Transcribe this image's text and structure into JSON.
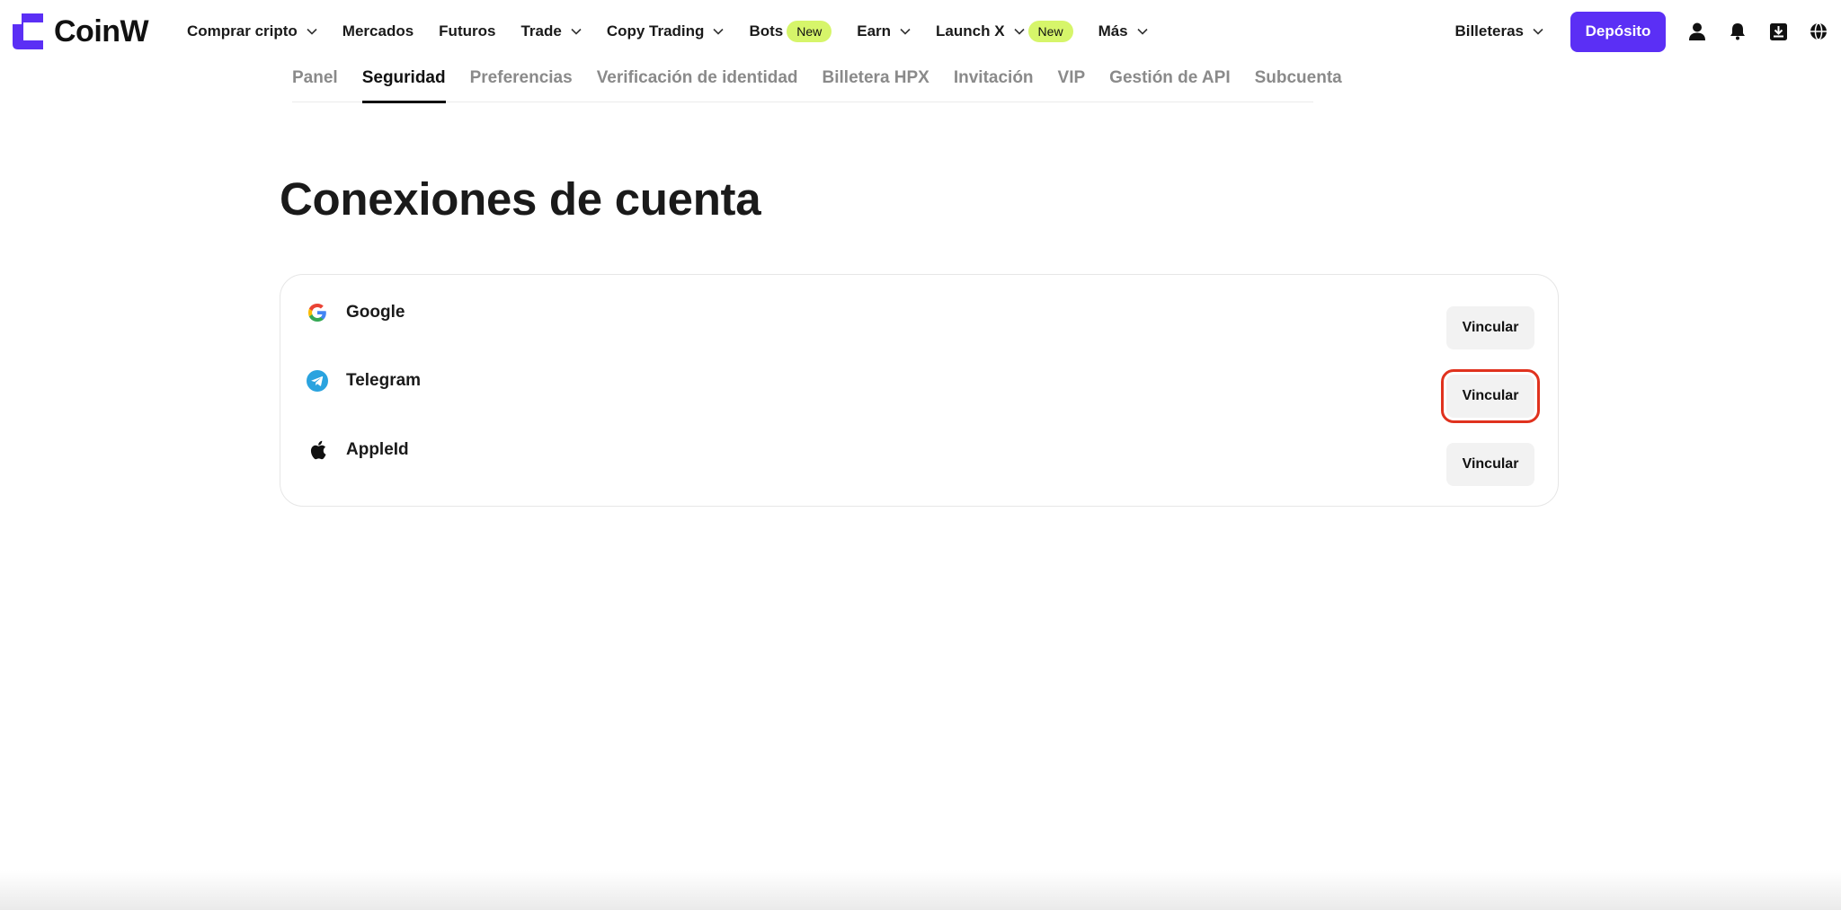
{
  "brand": {
    "name": "CoinW",
    "accent": "#5b2ff5"
  },
  "nav": {
    "items": [
      {
        "label": "Comprar cripto",
        "dropdown": true,
        "badge": ""
      },
      {
        "label": "Mercados",
        "dropdown": false,
        "badge": ""
      },
      {
        "label": "Futuros",
        "dropdown": false,
        "badge": ""
      },
      {
        "label": "Trade",
        "dropdown": true,
        "badge": ""
      },
      {
        "label": "Copy Trading",
        "dropdown": true,
        "badge": ""
      },
      {
        "label": "Bots",
        "dropdown": false,
        "badge": "New"
      },
      {
        "label": "Earn",
        "dropdown": true,
        "badge": ""
      },
      {
        "label": "Launch X",
        "dropdown": true,
        "badge": "New"
      },
      {
        "label": "Más",
        "dropdown": true,
        "badge": ""
      }
    ],
    "wallets_label": "Billeteras",
    "deposit_label": "Depósito",
    "icons": [
      "user-icon",
      "bell-icon",
      "download-icon",
      "globe-icon"
    ]
  },
  "subtabs": {
    "items": [
      {
        "label": "Panel",
        "active": false
      },
      {
        "label": "Seguridad",
        "active": true
      },
      {
        "label": "Preferencias",
        "active": false
      },
      {
        "label": "Verificación de identidad",
        "active": false
      },
      {
        "label": "Billetera HPX",
        "active": false
      },
      {
        "label": "Invitación",
        "active": false
      },
      {
        "label": "VIP",
        "active": false
      },
      {
        "label": "Gestión de API",
        "active": false
      },
      {
        "label": "Subcuenta",
        "active": false
      }
    ]
  },
  "main": {
    "title": "Conexiones de cuenta",
    "connections": [
      {
        "name": "Google",
        "icon": "google-icon",
        "button": "Vincular"
      },
      {
        "name": "Telegram",
        "icon": "telegram-icon",
        "button": "Vincular"
      },
      {
        "name": "AppleId",
        "icon": "apple-icon",
        "button": "Vincular"
      }
    ]
  },
  "colors": {
    "badge": "#d6f56a",
    "highlight": "#e0321e",
    "telegram": "#2aa3df"
  }
}
